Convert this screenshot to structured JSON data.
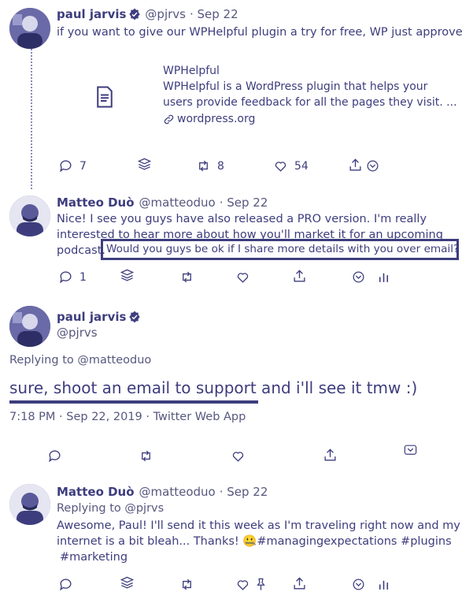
{
  "tweet1": {
    "author_name": "paul jarvis",
    "handle": "@pjrvs",
    "date": "· Sep 22",
    "text": "if you want to give our WPHelpful plugin a try for free, WP just approved it:",
    "card": {
      "title": "WPHelpful",
      "description_line1": "WPHelpful is a WordPress plugin that helps your",
      "description_line2": "users provide feedback for all the pages they visit. ...",
      "link": "wordpress.org",
      "icon": "document-icon"
    },
    "actions": {
      "replies": "7",
      "retweets": "8",
      "likes": "54"
    }
  },
  "tweet2": {
    "author_name": "Matteo Duò",
    "handle": "@matteoduo",
    "date": "· Sep 22",
    "text_line1": "Nice! I see you guys have also released a PRO version. I'm really",
    "text_line2": "interested to hear more about how you'll market it for an upcoming",
    "text_line3": "podcast.",
    "highlighted_text": "Would you guys be ok if I share more details with you over email?",
    "actions": {
      "replies": "1"
    }
  },
  "main_tweet": {
    "author_name": "paul jarvis",
    "handle": "@pjrvs",
    "replying_to": "Replying to @matteoduo",
    "text_underlined": "sure, shoot an email to support",
    "text_rest": " and i'll see it tmw :)",
    "meta": "7:18 PM · Sep 22, 2019 · Twitter Web App"
  },
  "tweet4": {
    "author_name": "Matteo Duò",
    "handle": "@matteoduo",
    "date": "· Sep 22",
    "replying_to": "Replying to @pjrvs",
    "text_line1": "Awesome, Paul! I'll send it this week as I'm traveling right now and my",
    "text_line2": "internet is a bit bleah... Thanks! 🤐#managingexpectations #plugins",
    "text_line3": "#marketing"
  },
  "colors": {
    "ink": "#3d3d7e",
    "background": "#ffffff"
  }
}
